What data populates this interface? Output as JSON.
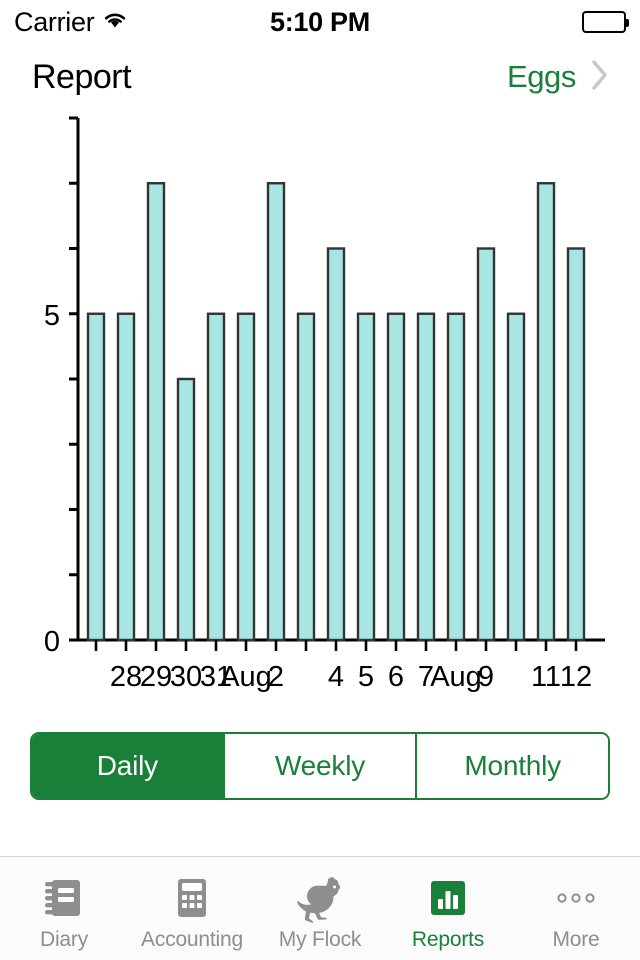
{
  "status_bar": {
    "carrier": "Carrier",
    "wifi_icon": "wifi-icon",
    "time": "5:10 PM",
    "battery_icon": "battery-full-icon"
  },
  "nav_bar": {
    "title": "Report",
    "action_label": "Eggs",
    "chevron_icon": "chevron-right-icon"
  },
  "segmented_control": {
    "options": [
      "Daily",
      "Weekly",
      "Monthly"
    ],
    "selected": "Daily",
    "accent_color": "#1a8039"
  },
  "tab_bar": {
    "items": [
      {
        "label": "Diary",
        "icon": "notebook-icon",
        "active": false
      },
      {
        "label": "Accounting",
        "icon": "calculator-icon",
        "active": false
      },
      {
        "label": "My Flock",
        "icon": "chicken-icon",
        "active": false
      },
      {
        "label": "Reports",
        "icon": "bar-chart-icon",
        "active": true
      },
      {
        "label": "More",
        "icon": "ellipsis-icon",
        "active": false
      }
    ],
    "inactive_color": "#8e8e8e",
    "active_color": "#1a8039"
  },
  "chart_data": {
    "type": "bar",
    "title": "",
    "xlabel": "",
    "ylabel": "",
    "ylim": [
      0,
      8
    ],
    "yticks": [
      0,
      1,
      2,
      3,
      4,
      5,
      6,
      7,
      8
    ],
    "ytick_labels": [
      "0",
      "",
      "",
      "",
      "",
      "5",
      "",
      "",
      ""
    ],
    "grid": false,
    "bar_fill": "#a8e6e3",
    "bar_stroke": "#333333",
    "categories": [
      "",
      "28",
      "29",
      "30",
      "31",
      "Aug",
      "2",
      "",
      "4",
      "5",
      "6",
      "7",
      "Aug",
      "9",
      "",
      "11",
      "12"
    ],
    "values": [
      5,
      5,
      7,
      4,
      5,
      5,
      7,
      5,
      6,
      5,
      5,
      5,
      5,
      6,
      5,
      7,
      6
    ]
  }
}
